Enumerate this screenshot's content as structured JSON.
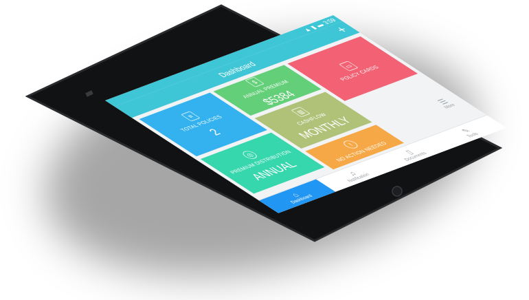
{
  "status_bar": {
    "time": "3:59",
    "icons": [
      "wifi-icon",
      "signal-icon",
      "battery-icon"
    ]
  },
  "app_bar": {
    "title": "Dashboard",
    "add_label": "+"
  },
  "tiles": {
    "total_policies": {
      "label": "TOTAL POLICIES",
      "value": "2"
    },
    "annual_premium": {
      "label": "ANNUAL PREMIUM",
      "value": "$5384"
    },
    "cashflow": {
      "label": "CASHFLOW",
      "value": "MONTHLY"
    },
    "premium_distribution": {
      "label": "PREMIUM DISTRIBUTION",
      "value": "ANNUAL"
    },
    "policy_cards": {
      "label": "POLICY CARDS"
    },
    "no_action": {
      "label": "NO ACTION NEEDED"
    }
  },
  "more": {
    "label": "More"
  },
  "bottom_nav": [
    {
      "label": "Dashboard",
      "icon": "home-icon"
    },
    {
      "label": "Notification",
      "icon": "bell-icon"
    },
    {
      "label": "Documents",
      "icon": "document-icon"
    },
    {
      "label": "Tools",
      "icon": "tools-icon"
    }
  ],
  "colors": {
    "appbar": "#3fc6d6",
    "total_policies": "#33b2ef",
    "annual_premium": "#63cf78",
    "cashflow": "#b0c178",
    "premium_distribution": "#37d7ad",
    "policy_cards": "#f26174",
    "no_action": "#f6a846",
    "nav_active": "#2196f3"
  }
}
